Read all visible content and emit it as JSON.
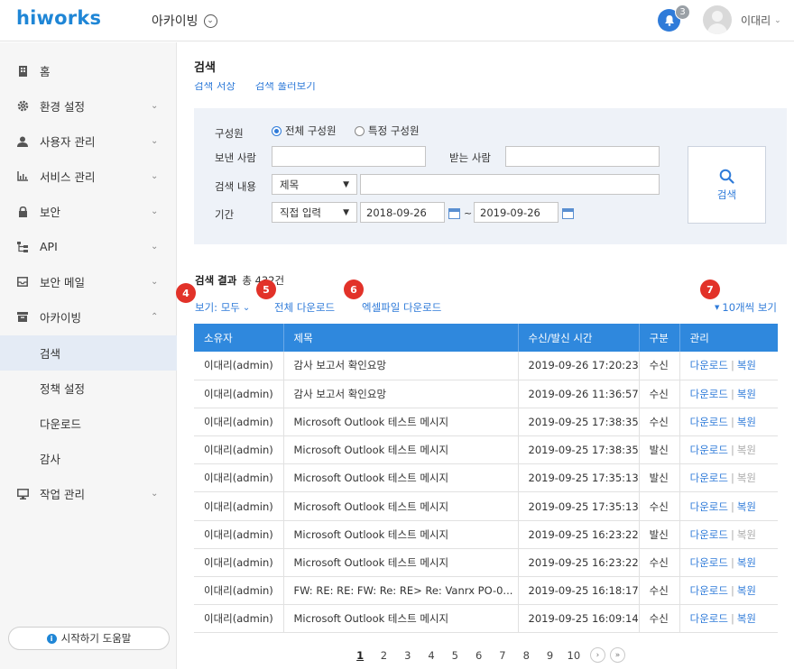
{
  "header": {
    "logo": "hiworks",
    "app_title": "아카이빙",
    "notification_count": "3",
    "user_name": "이대리"
  },
  "sidebar": {
    "items": [
      {
        "label": "홈",
        "icon": "building-icon"
      },
      {
        "label": "환경 설정",
        "icon": "gear-icon"
      },
      {
        "label": "사용자 관리",
        "icon": "user-icon"
      },
      {
        "label": "서비스 관리",
        "icon": "chart-icon"
      },
      {
        "label": "보안",
        "icon": "lock-icon"
      },
      {
        "label": "API",
        "icon": "tree-icon"
      },
      {
        "label": "보안 메일",
        "icon": "mail-icon"
      },
      {
        "label": "아카이빙",
        "icon": "archive-icon"
      }
    ],
    "sub_items": [
      "검색",
      "정책 설정",
      "다운로드",
      "감사"
    ],
    "last_item": {
      "label": "작업 관리",
      "icon": "monitor-icon"
    },
    "help_button": "시작하기 도움말"
  },
  "main": {
    "title": "검색",
    "tabs": [
      "검색 서상",
      "검색 풀러보기"
    ],
    "form": {
      "member_label": "구성원",
      "radio_all": "전체 구성원",
      "radio_specific": "특정 구성원",
      "sender_label": "보낸 사람",
      "receiver_label": "받는 사람",
      "content_label": "검색 내용",
      "content_select": "제목",
      "period_label": "기간",
      "period_select": "직접 입력",
      "date_from": "2018-09-26",
      "date_to": "2019-09-26",
      "tilde": "~",
      "search_button": "검색"
    },
    "results": {
      "title": "검색 결과",
      "count": "총 432건",
      "view_all": "보기: 모두",
      "download_all": "전체 다운로드",
      "excel_download": "엑셀파일 다운로드",
      "per_page": "10개씩 보기",
      "callouts": [
        "4",
        "5",
        "6",
        "7"
      ]
    },
    "table": {
      "columns": [
        "소유자",
        "제목",
        "수신/발신 시간",
        "구분",
        "관리"
      ],
      "download_label": "다운로드",
      "restore_label": "복원",
      "rows": [
        {
          "owner": "이대리(admin)",
          "subject": "감사 보고서 확인요망",
          "time": "2019-09-26 17:20:23",
          "type": "수신",
          "restore_enabled": true
        },
        {
          "owner": "이대리(admin)",
          "subject": "감사 보고서 확인요망",
          "time": "2019-09-26 11:36:57",
          "type": "수신",
          "restore_enabled": true
        },
        {
          "owner": "이대리(admin)",
          "subject": "Microsoft Outlook 테스트 메시지",
          "time": "2019-09-25 17:38:35",
          "type": "수신",
          "restore_enabled": true
        },
        {
          "owner": "이대리(admin)",
          "subject": "Microsoft Outlook 테스트 메시지",
          "time": "2019-09-25 17:38:35",
          "type": "발신",
          "restore_enabled": false
        },
        {
          "owner": "이대리(admin)",
          "subject": "Microsoft Outlook 테스트 메시지",
          "time": "2019-09-25 17:35:13",
          "type": "발신",
          "restore_enabled": false
        },
        {
          "owner": "이대리(admin)",
          "subject": "Microsoft Outlook 테스트 메시지",
          "time": "2019-09-25 17:35:13",
          "type": "수신",
          "restore_enabled": true
        },
        {
          "owner": "이대리(admin)",
          "subject": "Microsoft Outlook 테스트 메시지",
          "time": "2019-09-25 16:23:22",
          "type": "발신",
          "restore_enabled": false
        },
        {
          "owner": "이대리(admin)",
          "subject": "Microsoft Outlook 테스트 메시지",
          "time": "2019-09-25 16:23:22",
          "type": "수신",
          "restore_enabled": true
        },
        {
          "owner": "이대리(admin)",
          "subject": "FW: RE: RE: FW: Re: RE> Re: Vanrx PO-0...",
          "time": "2019-09-25 16:18:17",
          "type": "수신",
          "restore_enabled": true
        },
        {
          "owner": "이대리(admin)",
          "subject": "Microsoft Outlook 테스트 메시지",
          "time": "2019-09-25 16:09:14",
          "type": "수신",
          "restore_enabled": true
        }
      ]
    },
    "pagination": {
      "pages": [
        "1",
        "2",
        "3",
        "4",
        "5",
        "6",
        "7",
        "8",
        "9",
        "10"
      ],
      "current": "1",
      "next": "›",
      "last": "»"
    }
  }
}
